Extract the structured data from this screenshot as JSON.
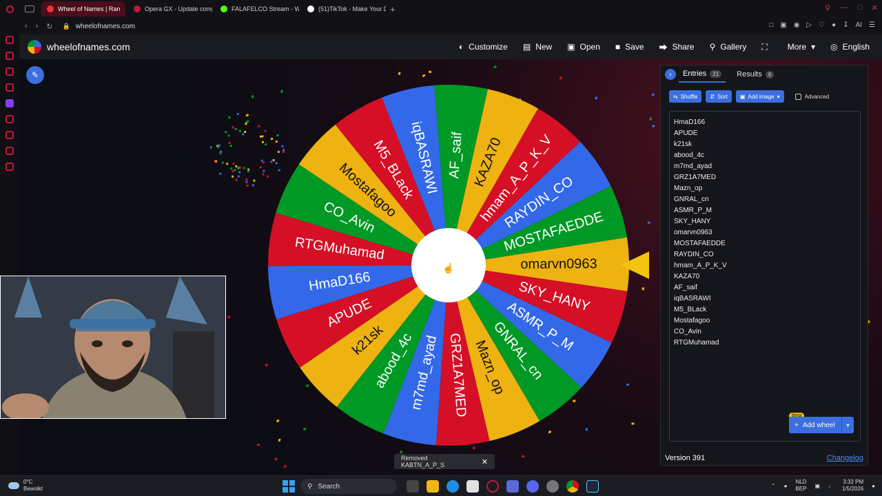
{
  "browser": {
    "tabs": [
      {
        "title": "Wheel of Names | Ran",
        "active": true,
        "color": "#e33"
      },
      {
        "title": "Opera GX - Update compl",
        "active": false,
        "color": "#c2183a"
      },
      {
        "title": "FALAFELCO Stream - Wat",
        "active": false,
        "color": "#53fc18"
      },
      {
        "title": "(51)TikTok - Make Your Da",
        "active": false,
        "color": "#ffffff"
      }
    ],
    "new_tab": "+",
    "url": "wheelofnames.com"
  },
  "site": {
    "name": "wheelofnames.com",
    "menu": [
      {
        "label": "Customize",
        "icon": "palette-icon"
      },
      {
        "label": "New",
        "icon": "file-icon"
      },
      {
        "label": "Open",
        "icon": "folder-icon"
      },
      {
        "label": "Save",
        "icon": "floppy-icon"
      },
      {
        "label": "Share",
        "icon": "share-icon"
      },
      {
        "label": "Gallery",
        "icon": "search-icon"
      },
      {
        "label": "",
        "icon": "fullscreen-icon"
      },
      {
        "label": "More",
        "icon": "chevron-down-icon"
      },
      {
        "label": "English",
        "icon": "globe-icon"
      }
    ]
  },
  "wheel": {
    "colors": [
      "#3369e8",
      "#009925",
      "#eeb211",
      "#d50f25"
    ],
    "segments": [
      "AF_saif",
      "KAZA70",
      "hmam_A_P_K_V",
      "RAYDIN_CO",
      "MOSTAFAEDDE",
      "omarvn0963",
      "SKY_HANY",
      "ASMR_P_M",
      "GNRAL_cn",
      "Mazn_op",
      "GRZ1A7MED",
      "m7md_ayad",
      "abood_4c",
      "k21sk",
      "APUDE",
      "HmaD166",
      "RTGMuhamad",
      "CO_Avin",
      "Mostafagoo",
      "M5_BLack",
      "iqBASRAWI"
    ],
    "segment_colors": [
      "#009925",
      "#eeb211",
      "#d50f25",
      "#3369e8",
      "#009925",
      "#eeb211",
      "#d50f25",
      "#3369e8",
      "#009925",
      "#eeb211",
      "#d50f25",
      "#3369e8",
      "#009925",
      "#eeb211",
      "#d50f25",
      "#3369e8",
      "#d50f25",
      "#009925",
      "#eeb211",
      "#d50f25",
      "#3369e8"
    ]
  },
  "panel": {
    "tabs": [
      {
        "label": "Entries",
        "count": "21"
      },
      {
        "label": "Results",
        "count": "6"
      }
    ],
    "tools": {
      "shuffle": "Shuffle",
      "sort": "Sort",
      "add_image": "Add image",
      "advanced": "Advanced"
    },
    "entries": [
      "HmaD166",
      "APUDE",
      "k21sk",
      "abood_4c",
      "m7md_ayad",
      "GRZ1A7MED",
      "Mazn_op",
      "GNRAL_cn",
      "ASMR_P_M",
      "SKY_HANY",
      "omarvn0963",
      "MOSTAFAEDDE",
      "RAYDIN_CO",
      "hmam_A_P_K_V",
      "KAZA70",
      "AF_saif",
      "iqBASRAWI",
      "M5_BLack",
      "Mostafagoo",
      "CO_Avin",
      "RTGMuhamad"
    ],
    "beta": "Beta",
    "add_wheel": "Add wheel",
    "version": "Version 391",
    "changelog": "Changelog"
  },
  "toast": {
    "text": "Removed KABTN_A_P_S"
  },
  "taskbar": {
    "temp": "0°C",
    "weather": "Bewolkt",
    "search": "Search",
    "lang": "NLD",
    "lang2": "BEP",
    "time": "3:32 PM",
    "date": "1/5/2026"
  }
}
